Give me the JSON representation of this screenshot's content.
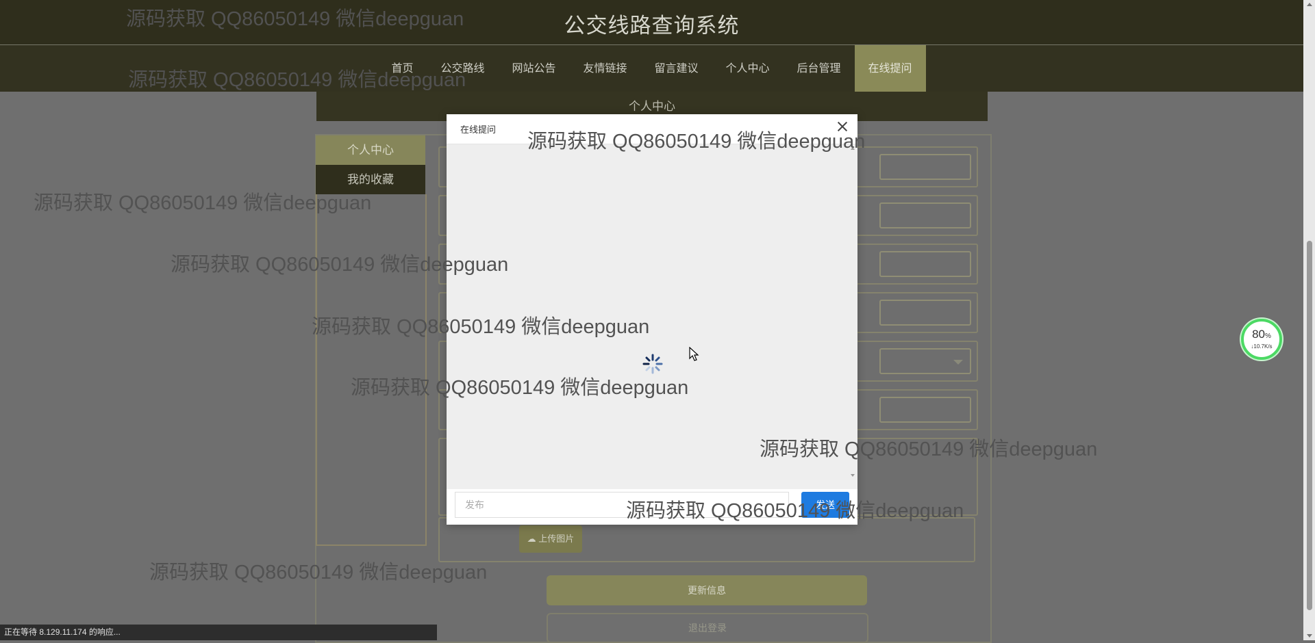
{
  "header": {
    "title": "公交线路查询系统"
  },
  "nav": {
    "items": [
      {
        "label": "首页"
      },
      {
        "label": "公交路线"
      },
      {
        "label": "网站公告"
      },
      {
        "label": "友情链接"
      },
      {
        "label": "留言建议"
      },
      {
        "label": "个人中心"
      },
      {
        "label": "后台管理"
      },
      {
        "label": "在线提问",
        "active": true
      }
    ]
  },
  "page": {
    "band_title": "个人中心",
    "side_menu": [
      {
        "label": "个人中心",
        "active": true
      },
      {
        "label": "我的收藏"
      }
    ],
    "upload_label": "上传图片",
    "update_label": "更新信息",
    "logout_label": "退出登录"
  },
  "modal": {
    "title": "在线提问",
    "input_placeholder": "发布",
    "send_label": "发送"
  },
  "status_bar": {
    "text": "正在等待 8.129.11.174 的响应..."
  },
  "speed_widget": {
    "percent": "80",
    "percent_unit": "%",
    "rate": "↓10.7K/s"
  },
  "watermark": {
    "text": "源码获取 QQ86050149 微信deepguan"
  },
  "colors": {
    "accent": "#86865a",
    "header": "#2f2e1c",
    "send": "#1e7be0",
    "widget_ring": "#4cd964"
  }
}
